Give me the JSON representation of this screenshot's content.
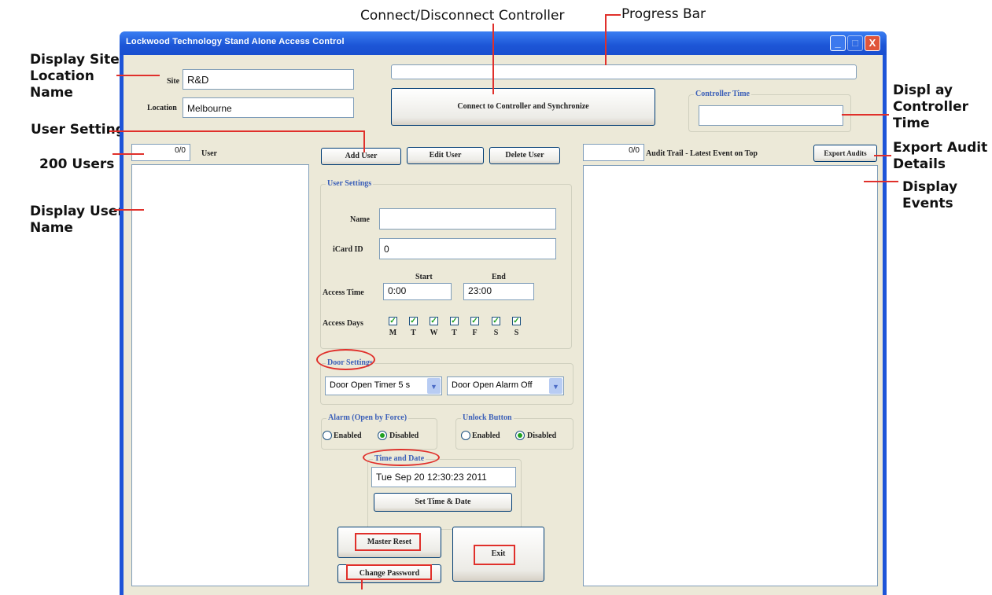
{
  "window": {
    "title": "Lockwood Technology Stand Alone Access Control",
    "minimize_label": "_",
    "maximize_label": "□",
    "close_label": "X"
  },
  "site": {
    "label": "Site",
    "value": "R&D"
  },
  "location": {
    "label": "Location",
    "value": "Melbourne"
  },
  "connect_button": "Connect to Controller and Synchronize",
  "controller_time": {
    "title": "Controller Time",
    "value": ""
  },
  "user_list": {
    "count": "0/0",
    "label": "User"
  },
  "user_buttons": {
    "add": "Add User",
    "edit": "Edit User",
    "delete": "Delete User"
  },
  "user_settings": {
    "title": "User Settings",
    "name_label": "Name",
    "name_value": "",
    "card_label": "iCard ID",
    "card_value": "0",
    "start_label": "Start",
    "end_label": "End",
    "access_time_label": "Access Time",
    "start_value": "0:00",
    "end_value": "23:00",
    "access_days_label": "Access Days",
    "days": [
      "M",
      "T",
      "W",
      "T",
      "F",
      "S",
      "S"
    ]
  },
  "door_settings": {
    "title": "Door Settings",
    "open_timer": "Door Open Timer 5 s",
    "open_alarm": "Door Open Alarm Off"
  },
  "alarm": {
    "title": "Alarm (Open by Force)",
    "enabled": "Enabled",
    "disabled": "Disabled"
  },
  "unlock": {
    "title": "Unlock Button",
    "enabled": "Enabled",
    "disabled": "Disabled"
  },
  "time_date": {
    "title": "Time and Date",
    "value": "Tue Sep 20 12:30:23 2011",
    "set_button": "Set Time & Date"
  },
  "master_reset": "Master Reset",
  "change_password": "Change Password",
  "exit": "Exit",
  "audit": {
    "count": "0/0",
    "label": "Audit Trail - Latest Event on Top",
    "export_button": "Export Audits"
  },
  "callouts": {
    "connect": "Connect/Disconnect Controller",
    "progress": "Progress Bar",
    "site": "Display Site &\nLocation\nName",
    "user_settings": "User Settings",
    "users200": "200 Users",
    "display_user": "Display User\nName",
    "controller_time": "Displ ay\nController\nTime",
    "export": "Export Audit\nDetails",
    "events": "Display\nEvents"
  },
  "colors": {
    "titlebar": "#1c55d6",
    "client": "#ece9d8",
    "annotation": "#e0302b",
    "group_title": "#3b5fb8"
  }
}
